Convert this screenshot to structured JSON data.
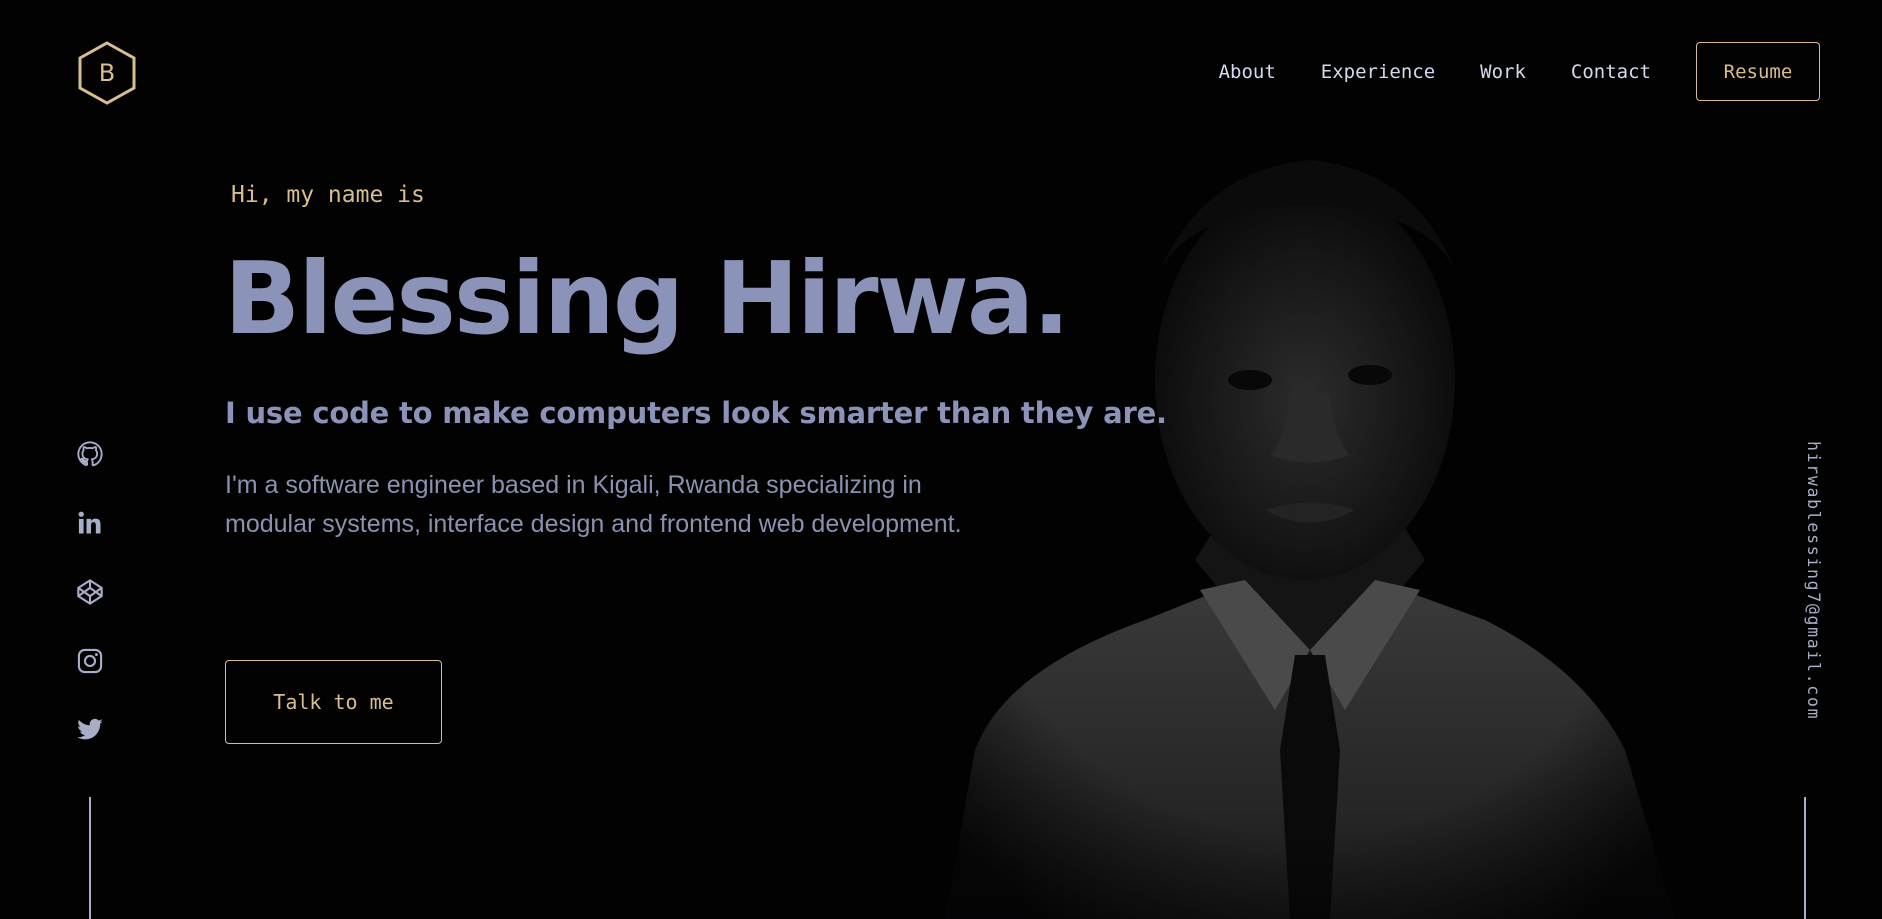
{
  "brand": {
    "logo_letter": "B"
  },
  "nav": {
    "links": [
      "About",
      "Experience",
      "Work",
      "Contact"
    ],
    "resume_label": "Resume"
  },
  "hero": {
    "intro": "Hi, my name is",
    "name": "Blessing Hirwa.",
    "tagline": "I use code to make computers look smarter than they are.",
    "bio": "I'm a software engineer based in Kigali, Rwanda specializing in modular systems, interface design and frontend web development.",
    "cta_label": "Talk to me"
  },
  "socials": [
    "github-icon",
    "linkedin-icon",
    "codepen-icon",
    "instagram-icon",
    "twitter-icon"
  ],
  "email": "hirwablessing7@gmail.com",
  "colors": {
    "accent": "#d8bd8f",
    "text": "#8b93b8",
    "background": "#020203",
    "nav_text": "#d5d9ee"
  }
}
